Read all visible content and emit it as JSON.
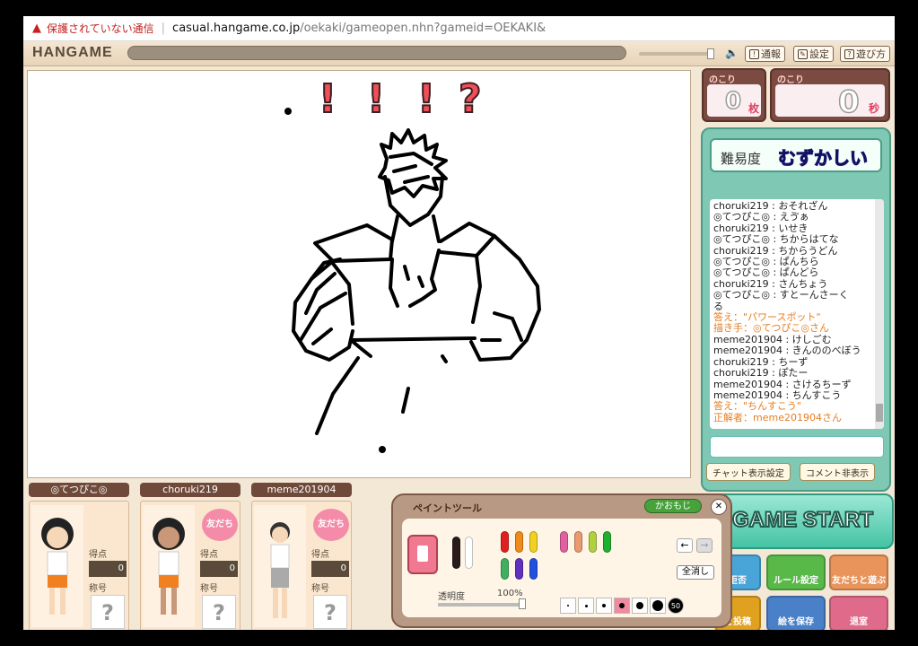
{
  "browser": {
    "warning_text": "保護されていない通信",
    "url_prefix": "casual.hangame.co.jp",
    "url_path": "/oekaki/gameopen.nhn?gameid=OEKAKI&"
  },
  "topbar": {
    "logo": "HANGAME",
    "buttons": [
      {
        "label": "通報",
        "icon": "report-icon"
      },
      {
        "label": "設定",
        "icon": "settings-icon"
      },
      {
        "label": "遊び方",
        "icon": "help-icon"
      }
    ]
  },
  "canvas": {
    "marks": [
      "!",
      "!",
      "!",
      "?"
    ]
  },
  "counters": {
    "cards": {
      "label": "のこり",
      "value": "0",
      "unit": "枚"
    },
    "seconds": {
      "label": "のこり",
      "value": "0",
      "unit": "秒"
    }
  },
  "difficulty": {
    "label": "難易度",
    "value": "むずかしい"
  },
  "chat": {
    "lines": [
      {
        "text": "choruki219 : おそれざん",
        "type": "normal"
      },
      {
        "text": "◎てつぴこ◎ : えゔぁ",
        "type": "normal"
      },
      {
        "text": "choruki219 : いせき",
        "type": "normal"
      },
      {
        "text": "◎てつぴこ◎ : ちからはてな",
        "type": "normal"
      },
      {
        "text": "choruki219 : ちからうどん",
        "type": "normal"
      },
      {
        "text": "◎てつぴこ◎ : ぱんちら",
        "type": "normal"
      },
      {
        "text": "◎てつぴこ◎ : ぱんどら",
        "type": "normal"
      },
      {
        "text": "choruki219 : さんちょう",
        "type": "normal"
      },
      {
        "text": "◎てつぴこ◎ : すとーんさーく",
        "type": "normal"
      },
      {
        "text": "る",
        "type": "normal"
      },
      {
        "text": "答え：\"パワースポット\"",
        "type": "ans"
      },
      {
        "text": "描き手：◎てつぴこ◎さん",
        "type": "ans"
      },
      {
        "text": "meme201904 : けしごむ",
        "type": "normal"
      },
      {
        "text": "meme201904 : きんののべぼう",
        "type": "normal"
      },
      {
        "text": "choruki219 : ちーず",
        "type": "normal"
      },
      {
        "text": "choruki219 : ぽたー",
        "type": "normal"
      },
      {
        "text": "meme201904 : さけるちーず",
        "type": "normal"
      },
      {
        "text": "meme201904 : ちんすこう",
        "type": "normal"
      },
      {
        "text": "答え：\"ちんすこう\"",
        "type": "ans"
      },
      {
        "text": "正解者：meme201904さん",
        "type": "ans"
      }
    ],
    "input_value": "",
    "settings_button": "チャット表示設定",
    "hide_comments_button": "コメント非表示"
  },
  "game_start": "GAME START",
  "side_buttons": [
    {
      "label": "拒否",
      "color": "#49a5d8"
    },
    {
      "label": "ルール設定",
      "color": "#58b848"
    },
    {
      "label": "友だちと遊ぶ",
      "color": "#e8945a"
    },
    {
      "label": "を投稿",
      "color": "#e0a020"
    },
    {
      "label": "絵を保存",
      "color": "#4a80c8"
    },
    {
      "label": "退室",
      "color": "#e06a8a"
    }
  ],
  "players": [
    {
      "name": "◎てつぴこ◎",
      "score_label": "得点",
      "score": "0",
      "title_label": "称号",
      "title_value": "?",
      "friend": ""
    },
    {
      "name": "choruki219",
      "score_label": "得点",
      "score": "0",
      "title_label": "称号",
      "title_value": "?",
      "friend": "友だち"
    },
    {
      "name": "meme201904",
      "score_label": "得点",
      "score": "0",
      "title_label": "称号",
      "title_value": "?",
      "friend": "友だち"
    }
  ],
  "paint_tool": {
    "title": "ペイントツール",
    "face_button": "かおもじ",
    "opacity_label": "透明度",
    "opacity_value": "100%",
    "clear_button": "全消し",
    "size_max_label": "50",
    "pens": [
      "#2a1a1a",
      "#ffffff",
      "#e02020",
      "#f08a1a",
      "#f0d020",
      "#e060a0",
      "#e89a70",
      "#b0d040",
      "#40b060",
      "#6030c0",
      "#2050e0",
      "#20b030"
    ]
  }
}
